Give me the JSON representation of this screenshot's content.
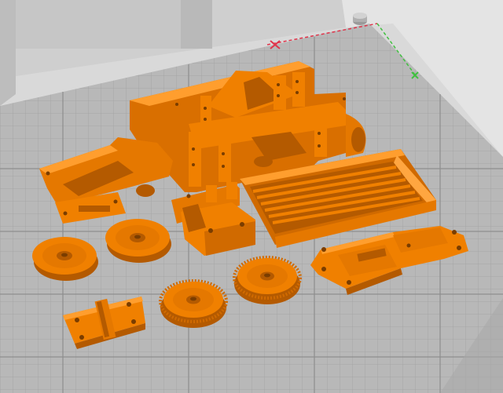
{
  "viewport": {
    "kind": "3d-print-build-plate",
    "colors": {
      "background": "#d9d9d9",
      "plate": "#b8b8b8",
      "grid_minor": "#a4a4a4",
      "grid_major": "#8e8e8e",
      "wall": "#cfcfcf",
      "wall_shade": "#bdbdbd",
      "part_fill": "#f08000",
      "part_dark": "#b45a00",
      "part_light": "#ff9e2e",
      "axis_x": "#e0344a",
      "axis_y": "#40c040"
    }
  },
  "parts": [
    {
      "name": "frame-chassis"
    },
    {
      "name": "side-rail"
    },
    {
      "name": "motor-mount-block"
    },
    {
      "name": "slotted-tray"
    },
    {
      "name": "wheel-1"
    },
    {
      "name": "wheel-2"
    },
    {
      "name": "gear-1"
    },
    {
      "name": "gear-2"
    },
    {
      "name": "hinge-plate"
    },
    {
      "name": "bracket-plate"
    }
  ],
  "icons": {
    "origin_marker": "origin-marker-icon",
    "axis_x": "axis-x-icon",
    "axis_y": "axis-y-icon"
  }
}
